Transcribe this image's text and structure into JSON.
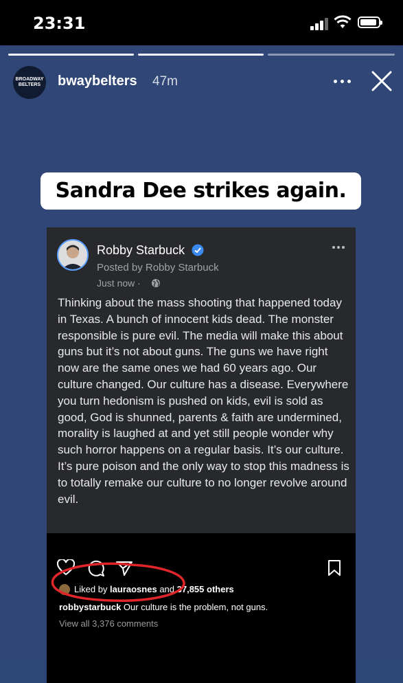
{
  "status_bar": {
    "time": "23:31"
  },
  "story": {
    "username": "bwaybelters",
    "age": "47m",
    "avatar_text": [
      "BROADWAY",
      "BELTERS"
    ],
    "caption": "Sandra Dee strikes again."
  },
  "post": {
    "author": "Robby Starbuck",
    "posted_by": "Posted by Robby  Starbuck",
    "time": "Just now ·",
    "body": "Thinking about the mass shooting that happened today in Texas. A bunch of innocent kids dead. The monster responsible is pure evil. The media will make this about guns but it’s not about guns. The guns we have right now are the same ones we had 60 years ago. Our culture changed. Our culture has a disease. Everywhere you turn hedonism is pushed on kids, evil is sold as good, God is shunned, parents & faith are undermined, morality is laughed at and yet still people wonder why such horror happens on a regular basis. It’s our culture. It’s pure poison and the only way to stop this madness is to totally remake our culture to no longer revolve around evil."
  },
  "ig": {
    "liked_prefix": "Liked by ",
    "liked_user": "lauraosnes",
    "liked_mid": " and ",
    "liked_count": "37,855 others",
    "caption_user": "robbystarbuck",
    "caption_text": " Our culture is the problem, not guns.",
    "comments": "View all 3,376 comments"
  },
  "colors": {
    "story_bg": "#2f4677",
    "post_bg": "#28292c",
    "annotation": "#e0262a"
  }
}
